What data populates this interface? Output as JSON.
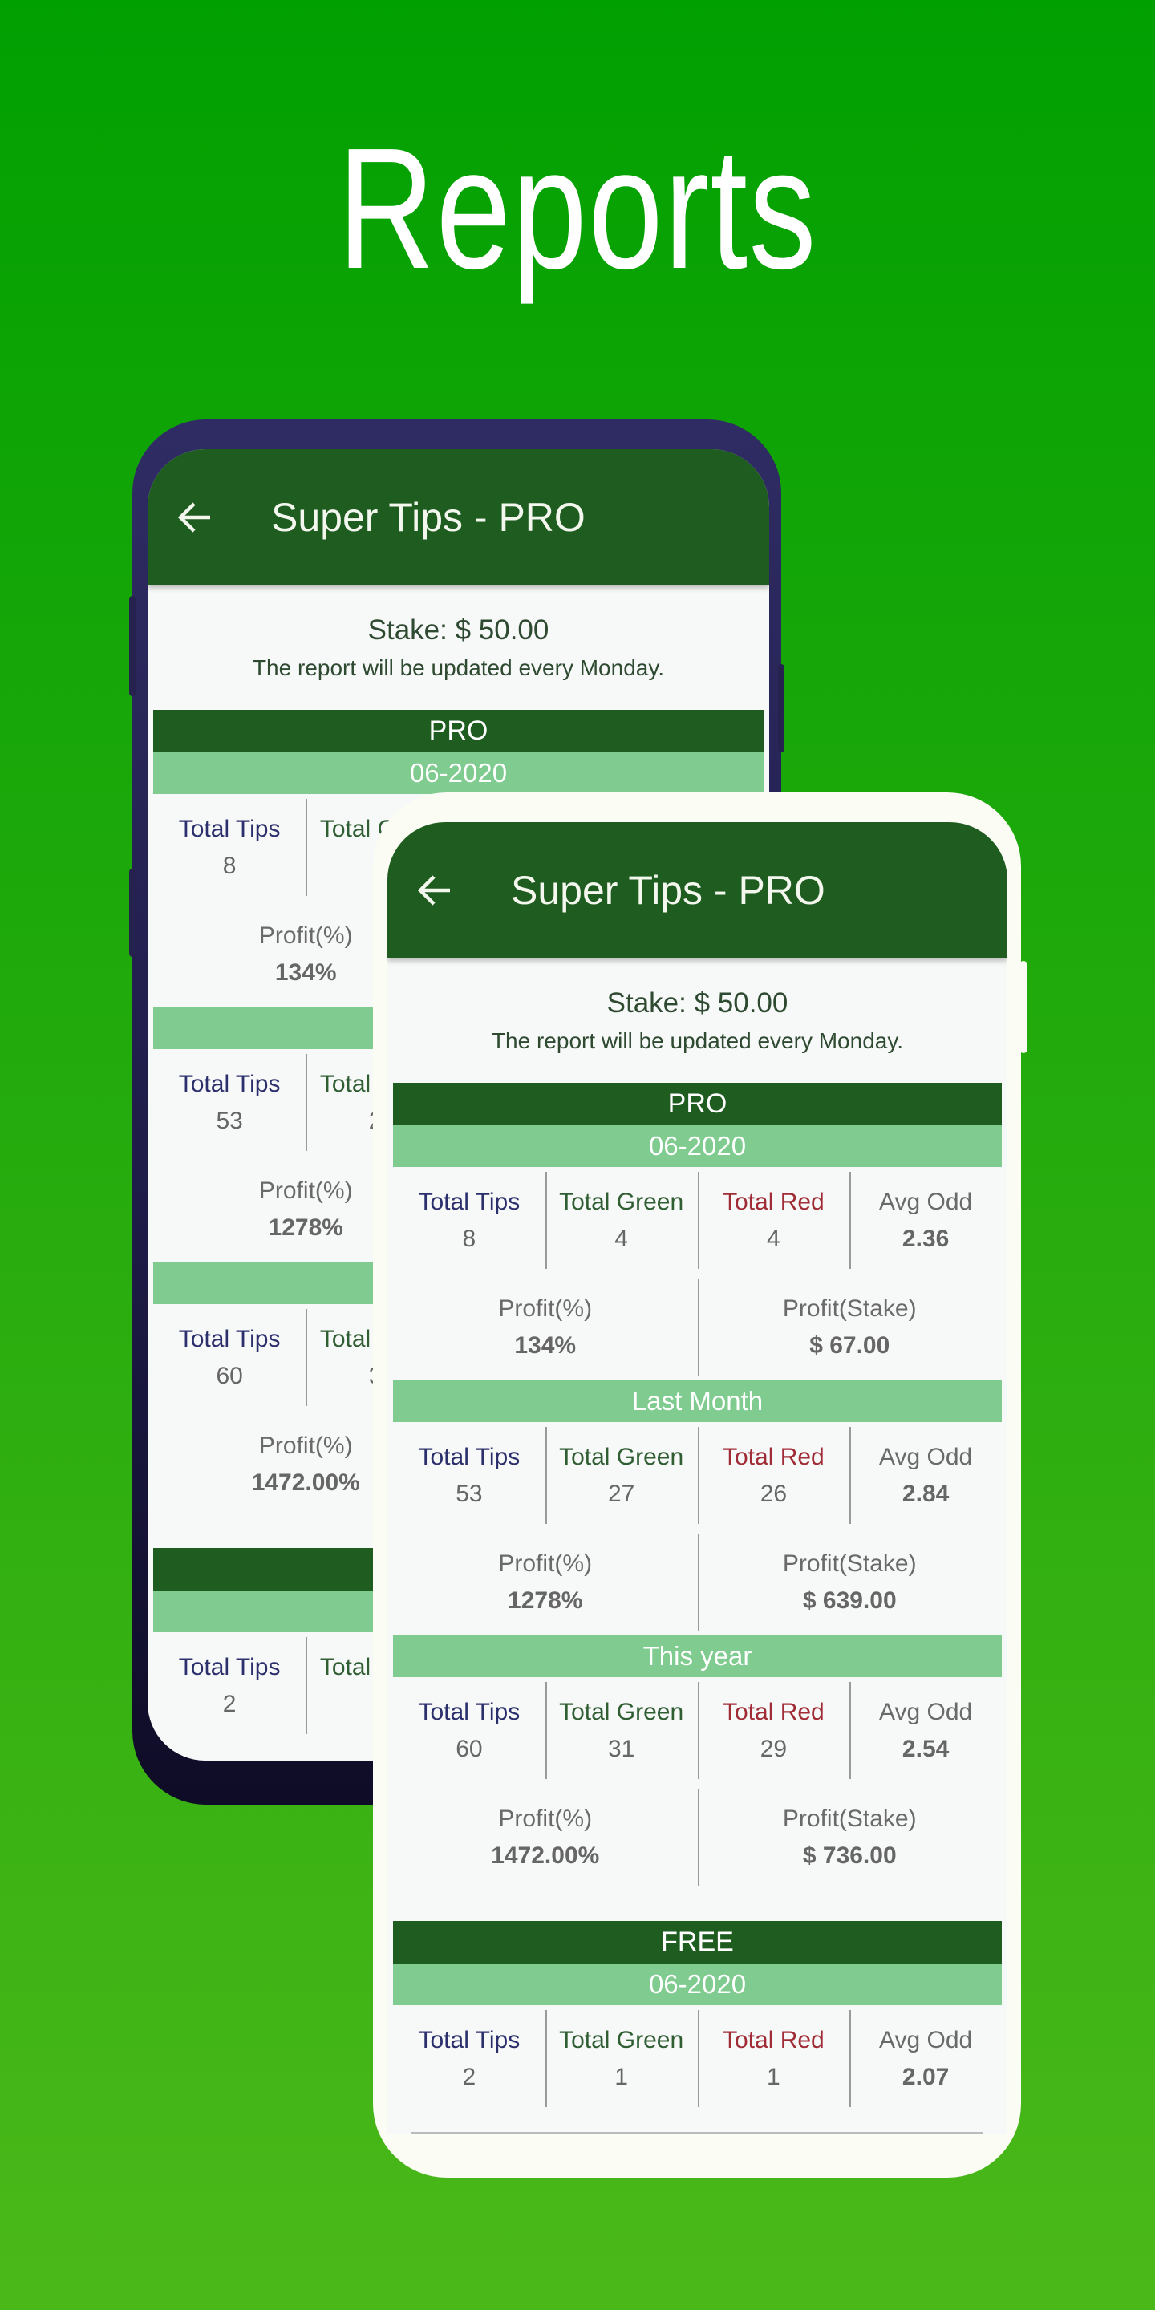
{
  "headline": "Reports",
  "app": {
    "title": "Super Tips - PRO",
    "back_icon": "arrow-left-icon",
    "stake": "Stake: $ 50.00",
    "notice": "The report will be updated every Monday."
  },
  "labels": {
    "total_tips": "Total Tips",
    "total_green": "Total Green",
    "total_red": "Total Red",
    "avg_odd": "Avg Odd",
    "profit_pct": "Profit(%)",
    "profit_stake": "Profit(Stake)"
  },
  "colors": {
    "background_top": "#01a001",
    "background_bottom": "#4bb819",
    "appbar": "#1e5c20",
    "period_bar": "#80cc90",
    "total_tips": "#2b2f6c",
    "total_green": "#2f5e32",
    "total_red": "#a02d36"
  },
  "groups": [
    {
      "title": "PRO",
      "sections": [
        {
          "period": "06-2020",
          "total_tips": "8",
          "total_green": "4",
          "total_red": "4",
          "avg_odd": "2.36",
          "profit_pct": "134%",
          "profit_stake": "$ 67.00"
        },
        {
          "period": "Last Month",
          "total_tips": "53",
          "total_green": "27",
          "total_red": "26",
          "avg_odd": "2.84",
          "profit_pct": "1278%",
          "profit_stake": "$ 639.00"
        },
        {
          "period": "This year",
          "total_tips": "60",
          "total_green": "31",
          "total_red": "29",
          "avg_odd": "2.54",
          "profit_pct": "1472.00%",
          "profit_stake": "$ 736.00"
        }
      ]
    },
    {
      "title": "FREE",
      "sections": [
        {
          "period": "06-2020",
          "total_tips": "2",
          "total_green": "1",
          "total_red": "1",
          "avg_odd": "2.07"
        }
      ]
    }
  ]
}
